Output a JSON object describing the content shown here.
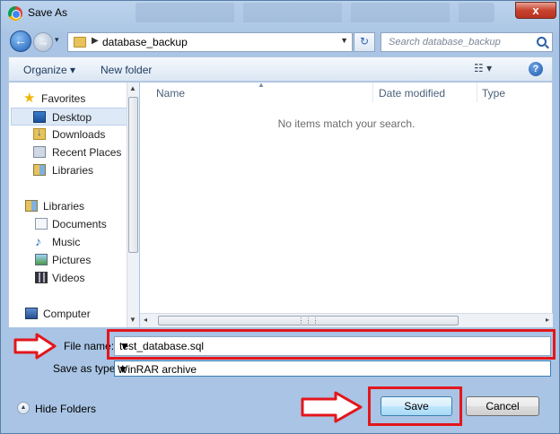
{
  "window": {
    "title": "Save As",
    "close_label": "x"
  },
  "address_bar": {
    "path_segment": "database_backup",
    "search_placeholder": "Search database_backup"
  },
  "toolbar": {
    "organize_label": "Organize ▾",
    "new_folder_label": "New folder",
    "view_glyph": "☷ ▾",
    "help_glyph": "?"
  },
  "nav": {
    "favorites": "Favorites",
    "items": [
      {
        "label": "Desktop",
        "icon": "desktop-icon"
      },
      {
        "label": "Downloads",
        "icon": "downloads-icon"
      },
      {
        "label": "Recent Places",
        "icon": "recent-places-icon"
      },
      {
        "label": "Libraries",
        "icon": "libraries-icon"
      }
    ],
    "libraries": "Libraries",
    "library_items": [
      {
        "label": "Documents",
        "icon": "documents-icon"
      },
      {
        "label": "Music",
        "icon": "music-icon"
      },
      {
        "label": "Pictures",
        "icon": "pictures-icon"
      },
      {
        "label": "Videos",
        "icon": "videos-icon"
      }
    ],
    "computer": "Computer"
  },
  "file_list": {
    "columns": [
      "Name",
      "Date modified",
      "Type"
    ],
    "empty_message": "No items match your search."
  },
  "form": {
    "file_name_label": "File name:",
    "file_name_value": "test_database.sql",
    "save_type_label": "Save as type:",
    "save_type_value": "WinRAR archive"
  },
  "footer": {
    "hide_folders_label": "Hide Folders",
    "save_label": "Save",
    "cancel_label": "Cancel"
  },
  "colors": {
    "annotation_red": "#e3161c",
    "frame_blue": "#a9c4e4"
  }
}
